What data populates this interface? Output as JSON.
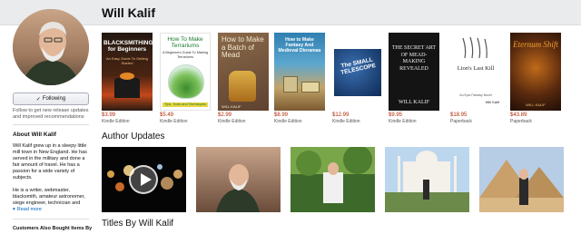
{
  "header": {
    "author_name": "Will Kalif"
  },
  "sidebar": {
    "follow_label": "Following",
    "follow_note": "Follow to get new release updates and improved recommendations",
    "about_title": "About Will Kalif",
    "bio_paragraphs": [
      "Will Kalif grew up in a sleepy little mill town in New England. He has served in the military and done a fair amount of travel. He has a passion for a wide variety of subjects.",
      "He is a writer, webmaster, blacksmith, amateur astronomer, siege engineer, technician and"
    ],
    "read_more": "Read more",
    "also_bought": "Customers Also Bought Items By"
  },
  "books": [
    {
      "cover_title": "BLACKSMITHING for Beginners",
      "cover_sub": "An Easy Guide To Getting Started",
      "price": "$3.99",
      "format": "Kindle Edition",
      "bg": "#2a1a12",
      "fg": "#ffffff"
    },
    {
      "cover_title": "How To Make Terrariums",
      "cover_sub": "A Beginners Guide To Making Terrariums",
      "cover_foot": "Tips, Tools and Techniques",
      "price": "$5.49",
      "format": "Kindle Edition",
      "bg": "#ffffff",
      "fg": "#1a7a2a"
    },
    {
      "cover_title": "How to Make a Batch of Mead",
      "cover_foot": "WILL KALIF",
      "price": "$2.99",
      "format": "Kindle Edition",
      "bg": "#7a5a3e",
      "fg": "#f4e8d0"
    },
    {
      "cover_title": "How to Make Fantasy And Medieval Dioramas",
      "price": "$8.99",
      "format": "Kindle Edition",
      "bg": "#3b8fb8",
      "fg": "#ffffff"
    },
    {
      "cover_title": "The SMALL TELESCOPE",
      "price": "$12.99",
      "format": "Kindle Edition",
      "bg": "#1c3f73",
      "fg": "#ffffff"
    },
    {
      "cover_title": "THE SECRET ART OF MEAD-MAKING REVEALED",
      "cover_foot": "WILL KALIF",
      "price": "$9.95",
      "format": "Kindle Edition",
      "bg": "#141414",
      "fg": "#f0f0f0"
    },
    {
      "cover_title": "Lion's Last Kill",
      "cover_sub": "An Epic Fantasy Novel",
      "cover_foot": "Will Kalif",
      "price": "$18.95",
      "format": "Paperback",
      "bg": "#ffffff",
      "fg": "#222222"
    },
    {
      "cover_title": "Eternum Shift",
      "cover_foot": "WILL KALIF",
      "price": "$43.89",
      "format": "Paperback",
      "bg": "#3a1d0c",
      "fg": "#f0a030"
    }
  ],
  "updates_title": "Author Updates",
  "titles_by": "Titles By Will Kalif",
  "colors": {
    "price": "#b12704",
    "link": "#0066c0",
    "header_band": "#e9ebec"
  }
}
